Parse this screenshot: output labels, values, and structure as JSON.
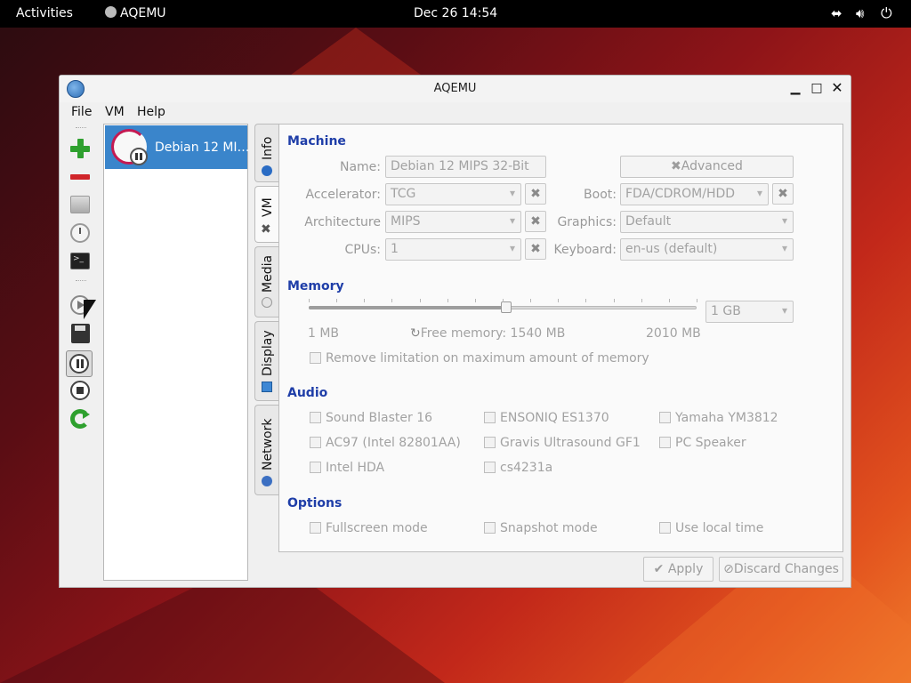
{
  "topbar": {
    "activities": "Activities",
    "app_name": "AQEMU",
    "clock": "Dec 26  14:54"
  },
  "window": {
    "title": "AQEMU",
    "menu": [
      "File",
      "VM",
      "Help"
    ]
  },
  "vm_list": {
    "items": [
      {
        "name": "Debian 12 MI…",
        "state": "paused"
      }
    ]
  },
  "tabs": [
    "Info",
    "VM",
    "Media",
    "Display",
    "Network"
  ],
  "active_tab": "VM",
  "machine": {
    "heading": "Machine",
    "name_label": "Name:",
    "name_value": "Debian 12 MIPS 32-Bit",
    "advanced_label": "Advanced",
    "accelerator_label": "Accelerator:",
    "accelerator_value": "TCG",
    "boot_label": "Boot:",
    "boot_value": "FDA/CDROM/HDD",
    "architecture_label": "Architecture",
    "architecture_value": "MIPS",
    "graphics_label": "Graphics:",
    "graphics_value": "Default",
    "cpus_label": "CPUs:",
    "cpus_value": "1",
    "keyboard_label": "Keyboard:",
    "keyboard_value": "en-us (default)"
  },
  "memory": {
    "heading": "Memory",
    "value": "1 GB",
    "min_label": "1 MB",
    "free_label": "Free memory: 1540 MB",
    "max_label": "2010 MB",
    "slider_fraction": 0.51,
    "remove_limit_label": "Remove limitation on maximum amount of memory"
  },
  "audio": {
    "heading": "Audio",
    "options": [
      "Sound Blaster 16",
      "ENSONIQ ES1370",
      "Yamaha YM3812",
      "AC97 (Intel 82801AA)",
      "Gravis Ultrasound GF1",
      "PC Speaker",
      "Intel HDA",
      "cs4231a"
    ]
  },
  "options": {
    "heading": "Options",
    "items": [
      "Fullscreen mode",
      "Snapshot mode",
      "Use local time"
    ]
  },
  "buttons": {
    "apply": "Apply",
    "discard": "Discard Changes"
  },
  "colors": {
    "accent": "#3a85cb",
    "section": "#1f3ea8"
  }
}
